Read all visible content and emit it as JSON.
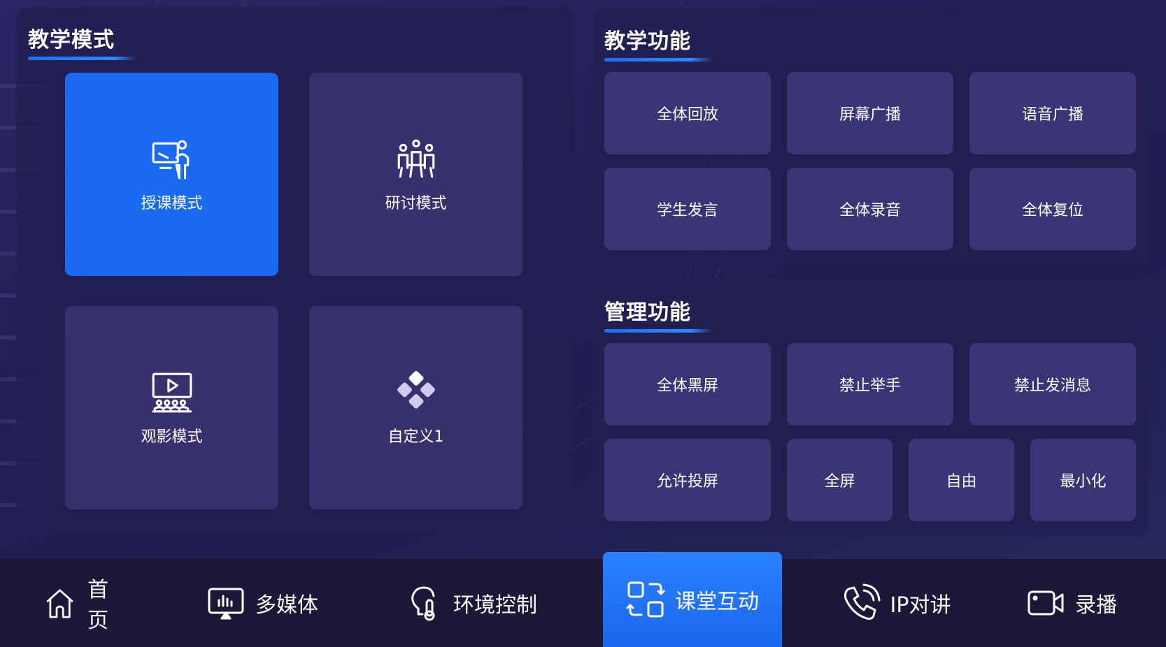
{
  "teaching_mode": {
    "title": "教学模式",
    "modes": [
      {
        "label": "授课模式",
        "icon": "teacher-presenting-icon",
        "active": true
      },
      {
        "label": "研讨模式",
        "icon": "discussion-group-icon",
        "active": false
      },
      {
        "label": "观影模式",
        "icon": "movie-audience-icon",
        "active": false
      },
      {
        "label": "自定义1",
        "icon": "custom-diamond-icon",
        "active": false
      }
    ]
  },
  "teaching_functions": {
    "title": "教学功能",
    "buttons": [
      "全体回放",
      "屏幕广播",
      "语音广播",
      "学生发言",
      "全体录音",
      "全体复位"
    ]
  },
  "management_functions": {
    "title": "管理功能",
    "buttons": [
      "全体黑屏",
      "禁止举手",
      "禁止发消息",
      "允许投屏",
      "全屏",
      "自由",
      "最小化"
    ]
  },
  "nav": {
    "items": [
      {
        "label": "首页",
        "icon": "home-icon"
      },
      {
        "label": "多媒体",
        "icon": "multimedia-monitor-icon"
      },
      {
        "label": "环境控制",
        "icon": "environment-bulb-icon"
      },
      {
        "label": "课堂互动",
        "icon": "class-interaction-icon",
        "active": true
      },
      {
        "label": "IP对讲",
        "icon": "phone-intercom-icon"
      },
      {
        "label": "录播",
        "icon": "video-camera-icon"
      }
    ]
  },
  "colors": {
    "accent": "#1b6bf2",
    "tile": "#37316e",
    "button": "#3a3575"
  }
}
